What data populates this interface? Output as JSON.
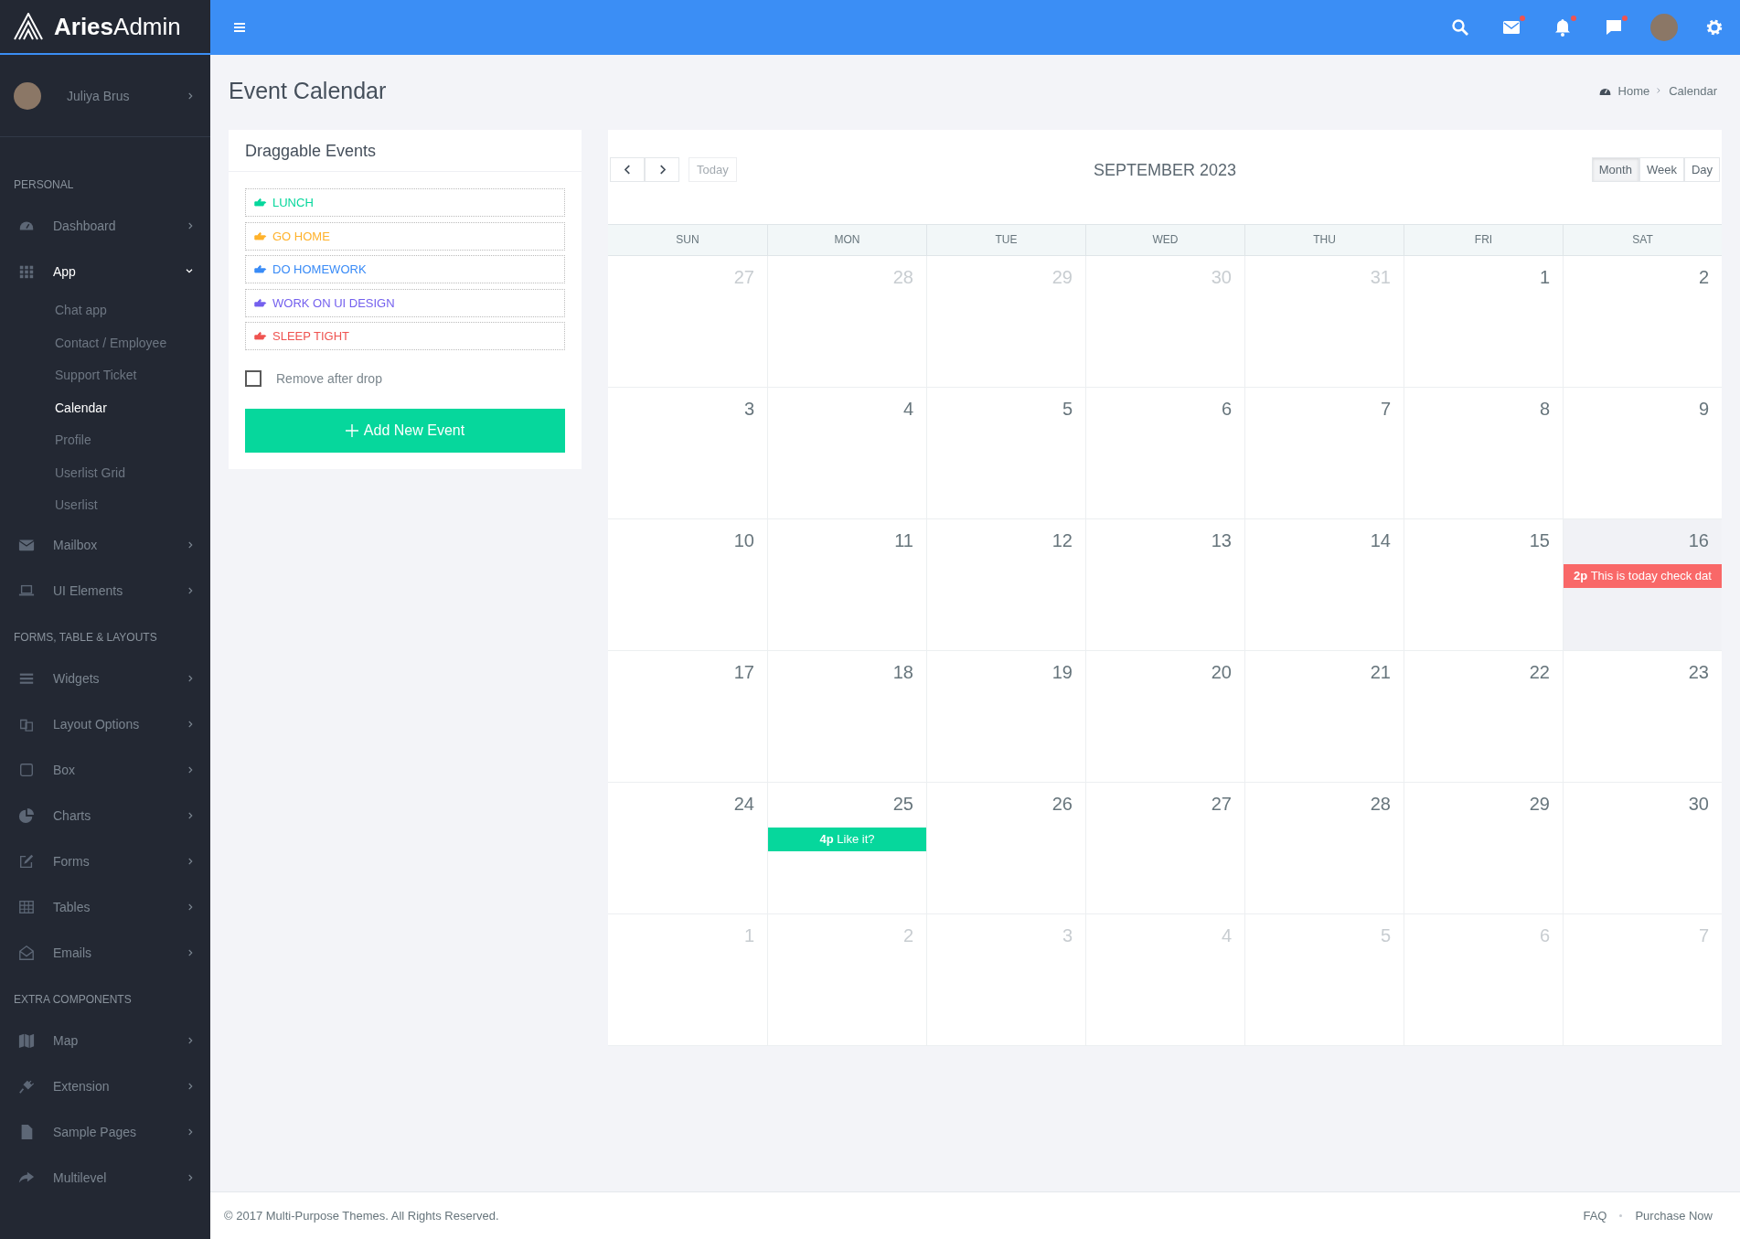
{
  "sidebar": {
    "logo": {
      "bold": "Aries",
      "light": "Admin"
    },
    "user": {
      "name": "Juliya Brus"
    },
    "sections": [
      {
        "heading": "PERSONAL",
        "items": [
          {
            "label": "Dashboard",
            "expanded": false
          },
          {
            "label": "App",
            "expanded": true,
            "children": [
              {
                "label": "Chat app",
                "selected": false
              },
              {
                "label": "Contact / Employee",
                "selected": false
              },
              {
                "label": "Support Ticket",
                "selected": false
              },
              {
                "label": "Calendar",
                "selected": true
              },
              {
                "label": "Profile",
                "selected": false
              },
              {
                "label": "Userlist Grid",
                "selected": false
              },
              {
                "label": "Userlist",
                "selected": false
              }
            ]
          },
          {
            "label": "Mailbox",
            "expanded": false
          },
          {
            "label": "UI Elements",
            "expanded": false
          }
        ]
      },
      {
        "heading": "FORMS, TABLE & LAYOUTS",
        "items": [
          {
            "label": "Widgets",
            "expanded": false
          },
          {
            "label": "Layout Options",
            "expanded": false
          },
          {
            "label": "Box",
            "expanded": false
          },
          {
            "label": "Charts",
            "expanded": false
          },
          {
            "label": "Forms",
            "expanded": false
          },
          {
            "label": "Tables",
            "expanded": false
          },
          {
            "label": "Emails",
            "expanded": false
          }
        ]
      },
      {
        "heading": "EXTRA COMPONENTS",
        "items": [
          {
            "label": "Map",
            "expanded": false
          },
          {
            "label": "Extension",
            "expanded": false
          },
          {
            "label": "Sample Pages",
            "expanded": false
          },
          {
            "label": "Multilevel",
            "expanded": false
          }
        ]
      }
    ]
  },
  "topbar": {
    "icons": [
      {
        "dot": false
      },
      {
        "dot": true
      },
      {
        "dot": true
      },
      {
        "dot": true
      }
    ]
  },
  "page": {
    "title": "Event Calendar",
    "breadcrumb": [
      "Home",
      "Calendar"
    ]
  },
  "draggable": {
    "title": "Draggable Events",
    "events": [
      {
        "label": "LUNCH",
        "color": "#06d79c"
      },
      {
        "label": "GO HOME",
        "color": "#ffb22b"
      },
      {
        "label": "DO HOMEWORK",
        "color": "#398bf7"
      },
      {
        "label": "WORK ON UI DESIGN",
        "color": "#7460ee"
      },
      {
        "label": "SLEEP TIGHT",
        "color": "#ef5350"
      }
    ],
    "remove_after_drop": {
      "label": "Remove after drop",
      "checked": false
    },
    "add_button": "Add New Event"
  },
  "calendar": {
    "today_button": "Today",
    "title": "SEPTEMBER 2023",
    "views": [
      {
        "label": "Month",
        "selected": true
      },
      {
        "label": "Week",
        "selected": false
      },
      {
        "label": "Day",
        "selected": false
      }
    ],
    "weekdays": [
      "SUN",
      "MON",
      "TUE",
      "WED",
      "THU",
      "FRI",
      "SAT"
    ],
    "weeks": [
      [
        {
          "day": "27",
          "muted": true,
          "today": false
        },
        {
          "day": "28",
          "muted": true,
          "today": false
        },
        {
          "day": "29",
          "muted": true,
          "today": false
        },
        {
          "day": "30",
          "muted": true,
          "today": false
        },
        {
          "day": "31",
          "muted": true,
          "today": false
        },
        {
          "day": "1",
          "muted": false,
          "today": false
        },
        {
          "day": "2",
          "muted": false,
          "today": false
        }
      ],
      [
        {
          "day": "3",
          "muted": false,
          "today": false
        },
        {
          "day": "4",
          "muted": false,
          "today": false
        },
        {
          "day": "5",
          "muted": false,
          "today": false
        },
        {
          "day": "6",
          "muted": false,
          "today": false
        },
        {
          "day": "7",
          "muted": false,
          "today": false
        },
        {
          "day": "8",
          "muted": false,
          "today": false
        },
        {
          "day": "9",
          "muted": false,
          "today": false
        }
      ],
      [
        {
          "day": "10",
          "muted": false,
          "today": false
        },
        {
          "day": "11",
          "muted": false,
          "today": false
        },
        {
          "day": "12",
          "muted": false,
          "today": false
        },
        {
          "day": "13",
          "muted": false,
          "today": false
        },
        {
          "day": "14",
          "muted": false,
          "today": false
        },
        {
          "day": "15",
          "muted": false,
          "today": false
        },
        {
          "day": "16",
          "muted": false,
          "today": true,
          "events": [
            {
              "time": "2p",
              "title": "This is today check dat",
              "color": "#f96868"
            }
          ]
        }
      ],
      [
        {
          "day": "17",
          "muted": false,
          "today": false
        },
        {
          "day": "18",
          "muted": false,
          "today": false
        },
        {
          "day": "19",
          "muted": false,
          "today": false
        },
        {
          "day": "20",
          "muted": false,
          "today": false
        },
        {
          "day": "21",
          "muted": false,
          "today": false
        },
        {
          "day": "22",
          "muted": false,
          "today": false
        },
        {
          "day": "23",
          "muted": false,
          "today": false
        }
      ],
      [
        {
          "day": "24",
          "muted": false,
          "today": false
        },
        {
          "day": "25",
          "muted": false,
          "today": false,
          "events": [
            {
              "time": "4p",
              "title": "Like it?",
              "color": "#06d79c"
            }
          ]
        },
        {
          "day": "26",
          "muted": false,
          "today": false
        },
        {
          "day": "27",
          "muted": false,
          "today": false
        },
        {
          "day": "28",
          "muted": false,
          "today": false
        },
        {
          "day": "29",
          "muted": false,
          "today": false
        },
        {
          "day": "30",
          "muted": false,
          "today": false
        }
      ],
      [
        {
          "day": "1",
          "muted": true,
          "today": false
        },
        {
          "day": "2",
          "muted": true,
          "today": false
        },
        {
          "day": "3",
          "muted": true,
          "today": false
        },
        {
          "day": "4",
          "muted": true,
          "today": false
        },
        {
          "day": "5",
          "muted": true,
          "today": false
        },
        {
          "day": "6",
          "muted": true,
          "today": false
        },
        {
          "day": "7",
          "muted": true,
          "today": false
        }
      ]
    ]
  },
  "footer": {
    "copyright": "© 2017 Multi-Purpose Themes. All Rights Reserved.",
    "links": [
      "FAQ",
      "Purchase Now"
    ]
  }
}
